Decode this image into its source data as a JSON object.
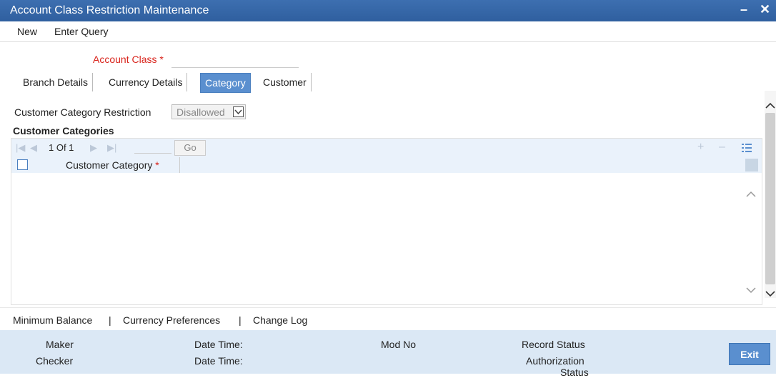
{
  "window": {
    "title": "Account Class Restriction Maintenance",
    "minimize": "–",
    "close": "✕"
  },
  "menu": {
    "new": "New",
    "enter_query": "Enter Query"
  },
  "form": {
    "account_class_label": "Account Class",
    "required_mark": "*",
    "account_class_value": ""
  },
  "tabs": [
    {
      "label": "Branch Details"
    },
    {
      "label": "Currency Details"
    },
    {
      "label": "Category"
    },
    {
      "label": "Customer"
    }
  ],
  "restriction": {
    "label": "Customer Category Restriction",
    "value": "Disallowed"
  },
  "categories": {
    "title": "Customer Categories",
    "pager_text": "1 Of 1",
    "go_label": "Go",
    "column_header": "Customer Category",
    "required_mark": "*"
  },
  "footer_links": {
    "min_balance": "Minimum Balance",
    "sep1": "|",
    "currency_prefs": "Currency Preferences",
    "sep2": "|",
    "change_log": "Change Log"
  },
  "status": {
    "maker": "Maker",
    "checker": "Checker",
    "date_time_1": "Date Time:",
    "date_time_2": "Date Time:",
    "mod_no": "Mod No",
    "record_status": "Record Status",
    "auth_status_1": "Authorization",
    "auth_status_2": "Status",
    "exit": "Exit"
  },
  "colors": {
    "title_bar": "#2f5f9f",
    "accent": "#5a8fcf",
    "required": "#d9241c",
    "status_bar": "#dbe8f5"
  }
}
